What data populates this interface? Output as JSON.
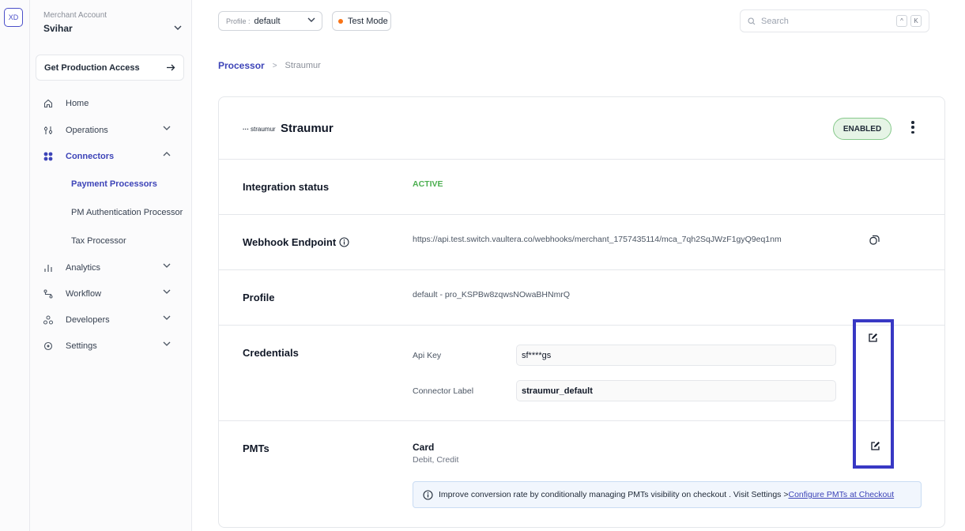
{
  "rail": {
    "avatar": "XD"
  },
  "sidebar": {
    "merchant_label": "Merchant Account",
    "merchant_name": "Svihar",
    "production_button": "Get Production Access",
    "nav": {
      "home": "Home",
      "operations": "Operations",
      "connectors": "Connectors",
      "payment_processors": "Payment Processors",
      "pm_auth": "PM Authentication Processor",
      "tax": "Tax Processor",
      "analytics": "Analytics",
      "workflow": "Workflow",
      "developers": "Developers",
      "settings": "Settings"
    }
  },
  "topbar": {
    "profile_label": "Profile :",
    "profile_value": "default",
    "test_mode": "Test Mode",
    "search_placeholder": "Search",
    "kbd_1": "^",
    "kbd_2": "K"
  },
  "breadcrumb": {
    "parent": "Processor",
    "separator": ">",
    "current": "Straumur"
  },
  "connector": {
    "logo_text": "straumur",
    "name": "Straumur",
    "status": "ENABLED",
    "integration_label": "Integration status",
    "integration_value": "ACTIVE",
    "webhook_label": "Webhook Endpoint",
    "webhook_value": "https://api.test.switch.vaultera.co/webhooks/merchant_1757435114/mca_7qh2SqJWzF1gyQ9eq1nm",
    "profile_label": "Profile",
    "profile_value": "default - pro_KSPBw8zqwsNOwaBHNmrQ",
    "credentials_label": "Credentials",
    "api_key_label": "Api Key",
    "api_key_value": "sf****gs",
    "connector_label_label": "Connector Label",
    "connector_label_value": "straumur_default",
    "pmts_label": "PMTs",
    "pm_title": "Card",
    "pm_sub": "Debit, Credit",
    "info_text": "Improve conversion rate by conditionally managing PMTs visibility on checkout . Visit Settings >",
    "info_link": "Configure PMTs at Checkout"
  },
  "colors": {
    "accent": "#3d44b8",
    "active_green": "#4caf50",
    "enabled_bg": "#e6f4e6",
    "test_dot": "#f97316",
    "highlight": "#3838c4"
  }
}
